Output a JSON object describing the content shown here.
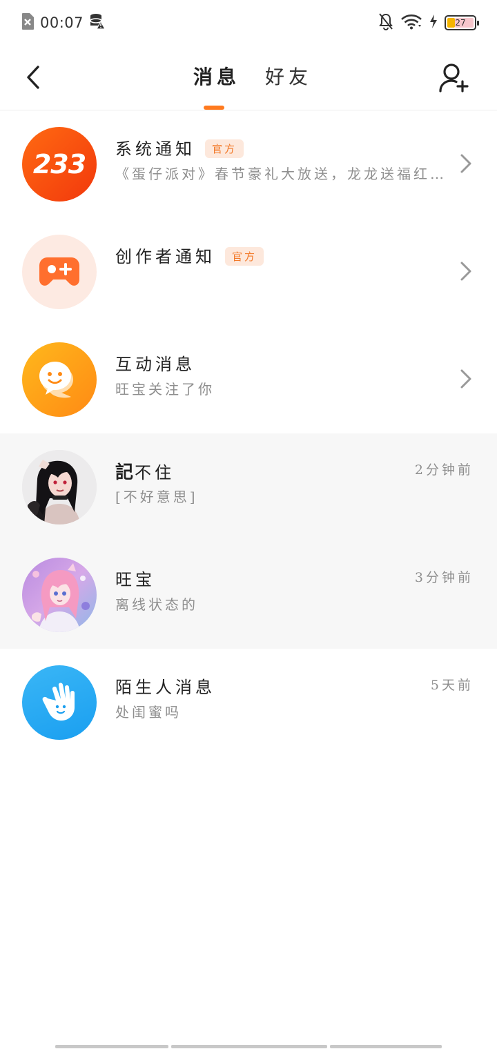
{
  "status_bar": {
    "time": "00:07",
    "battery_level": "27",
    "icons": [
      "sim-off-icon",
      "data-warning-icon",
      "bell-off-icon",
      "wifi-icon",
      "charging-icon",
      "battery-icon"
    ]
  },
  "header": {
    "back_icon": "back-arrow-icon",
    "tabs": [
      {
        "label": "消息",
        "active": true
      },
      {
        "label": "好友",
        "active": false
      }
    ],
    "add_friend_icon": "add-user-icon",
    "accent_color": "#ff7a1e"
  },
  "conversations": [
    {
      "name": "系统通知",
      "badge": "官方",
      "preview": "《蛋仔派对》春节豪礼大放送，龙龙送福红…",
      "time": "",
      "avatar_icon": "233-logo-icon",
      "avatar_text": "233",
      "chevron": true
    },
    {
      "name": "创作者通知",
      "badge": "官方",
      "preview": "",
      "time": "",
      "avatar_icon": "gamepad-icon",
      "chevron": true
    },
    {
      "name": "互动消息",
      "badge": "",
      "preview": "旺宝关注了你",
      "time": "",
      "avatar_icon": "chat-bubble-icon",
      "chevron": true
    },
    {
      "name_bold_part": "記",
      "name": "不住",
      "badge": "",
      "preview": "[不好意思]",
      "time": "2分钟前",
      "avatar_icon": "user-avatar-anime-icon",
      "chevron": false
    },
    {
      "name": "旺宝",
      "badge": "",
      "preview": "离线状态的",
      "time": "3分钟前",
      "avatar_icon": "user-avatar-pink-icon",
      "chevron": false
    },
    {
      "name": "陌生人消息",
      "badge": "",
      "preview": "处闺蜜吗",
      "time": "5天前",
      "avatar_icon": "hand-wave-icon",
      "chevron": false
    }
  ]
}
